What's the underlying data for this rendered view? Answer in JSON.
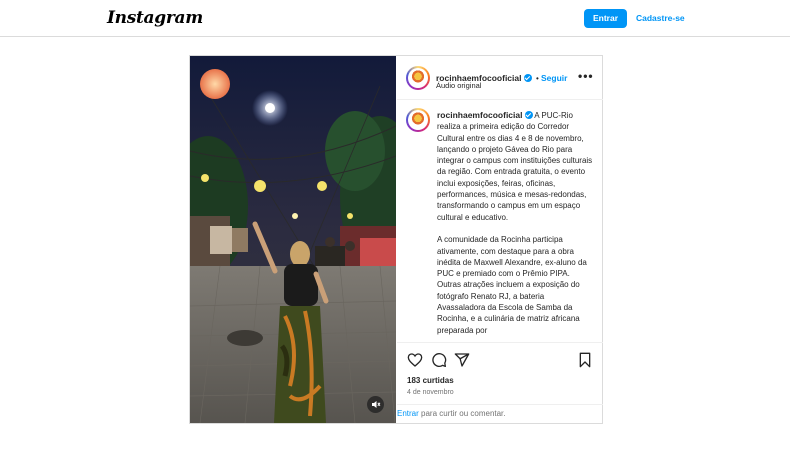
{
  "header": {
    "logo": "Instagram",
    "login_label": "Entrar",
    "signup_label": "Cadastre-se"
  },
  "post": {
    "username": "rocinhaemfocooficial",
    "follow_label": "Seguir",
    "audio": "Áudio original",
    "more_label": "•••",
    "caption_p1_rest": "A PUC-Rio realiza a primeira edição do Corredor Cultural entre os dias 4 e 8 de novembro, lançando o projeto Gávea do Rio para integrar o campus com instituições culturais da região. Com entrada gratuita, o evento inclui exposições, feiras, oficinas, performances, música e mesas-redondas, transformando o campus em um espaço cultural e educativo.",
    "caption_p2": "A comunidade da Rocinha participa ativamente, com destaque para a obra inédita de Maxwell Alexandre, ex-aluno da PUC e premiado com o Prêmio PIPA. Outras atrações incluem a exposição do fotógrafo Renato RJ, a bateria Avassaladora da Escola de Samba da Rocinha, e a culinária de matriz africana preparada por",
    "likes": "183 curtidas",
    "date": "4 de novembro",
    "footer_link": "Entrar",
    "footer_text": " para curtir ou comentar."
  },
  "icons": {
    "like": "heart-icon",
    "comment": "comment-icon",
    "share": "share-icon",
    "save": "bookmark-icon",
    "mute": "speaker-muted-icon",
    "verified": "verified-badge-icon"
  },
  "colors": {
    "accent": "#0095f6",
    "border": "#dbdbdb",
    "text": "#262626",
    "muted": "#737373"
  }
}
